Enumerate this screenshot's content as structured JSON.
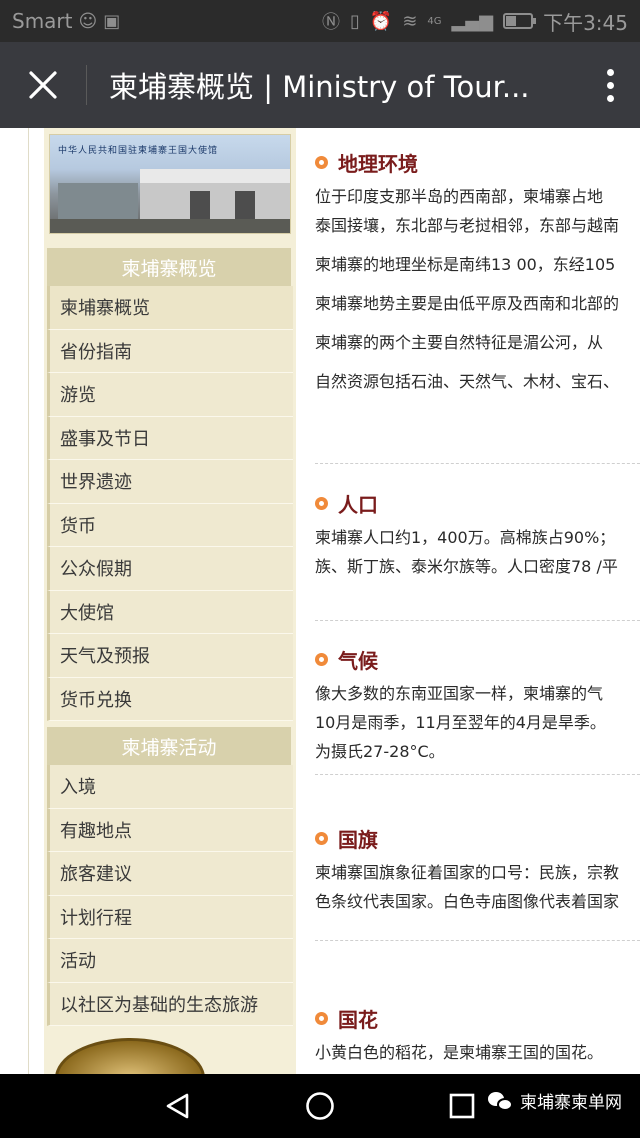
{
  "status_bar": {
    "carrier": "Smart",
    "time": "下午3:45",
    "network": "4G"
  },
  "title_bar": {
    "title": "柬埔寨概览 | Ministry of Tour..."
  },
  "sidebar": {
    "banner_caption": "中华人民共和国驻柬埔寨王国大使馆",
    "section1_title": "柬埔寨概览",
    "section1_items": [
      "柬埔寨概览",
      "省份指南",
      "游览",
      "盛事及节日",
      "世界遗迹",
      "货币",
      "公众假期",
      "大使馆",
      "天气及预报",
      "货币兑换"
    ],
    "section2_title": "柬埔寨活动",
    "section2_items": [
      "入境",
      "有趣地点",
      "旅客建议",
      "计划行程",
      "活动",
      "以社区为基础的生态旅游"
    ]
  },
  "main": {
    "sections": [
      {
        "heading": "地理环境",
        "paragraphs": [
          [
            "位于印度支那半岛的西南部，柬埔寨占地",
            "泰国接壤，东北部与老挝相邻，东部与越南"
          ],
          [
            "柬埔寨的地理坐标是南纬13 00，东经105"
          ],
          [
            "柬埔寨地势主要是由低平原及西南和北部的"
          ],
          [
            "柬埔寨的两个主要自然特征是湄公河，从"
          ],
          [
            "自然资源包括石油、天然气、木材、宝石、"
          ]
        ]
      },
      {
        "heading": "人口",
        "paragraphs": [
          [
            "柬埔寨人口约1，400万。高棉族占90%；",
            "族、斯丁族、泰米尔族等。人口密度78 /平"
          ]
        ]
      },
      {
        "heading": "气候",
        "paragraphs": [
          [
            "像大多数的东南亚国家一样，柬埔寨的气",
            "10月是雨季，11月至翌年的4月是旱季。",
            "为摄氏27-28°C。"
          ]
        ]
      },
      {
        "heading": "国旗",
        "paragraphs": [
          [
            "柬埔寨国旗象征着国家的口号：民族，宗教",
            "色条纹代表国家。白色寺庙图像代表着国家"
          ]
        ]
      },
      {
        "heading": "国花",
        "paragraphs": [
          [
            "小黄白色的稻花，是柬埔寨王国的国花。"
          ]
        ]
      }
    ]
  },
  "nav_bar": {
    "account_name": "柬埔寨柬单网"
  }
}
